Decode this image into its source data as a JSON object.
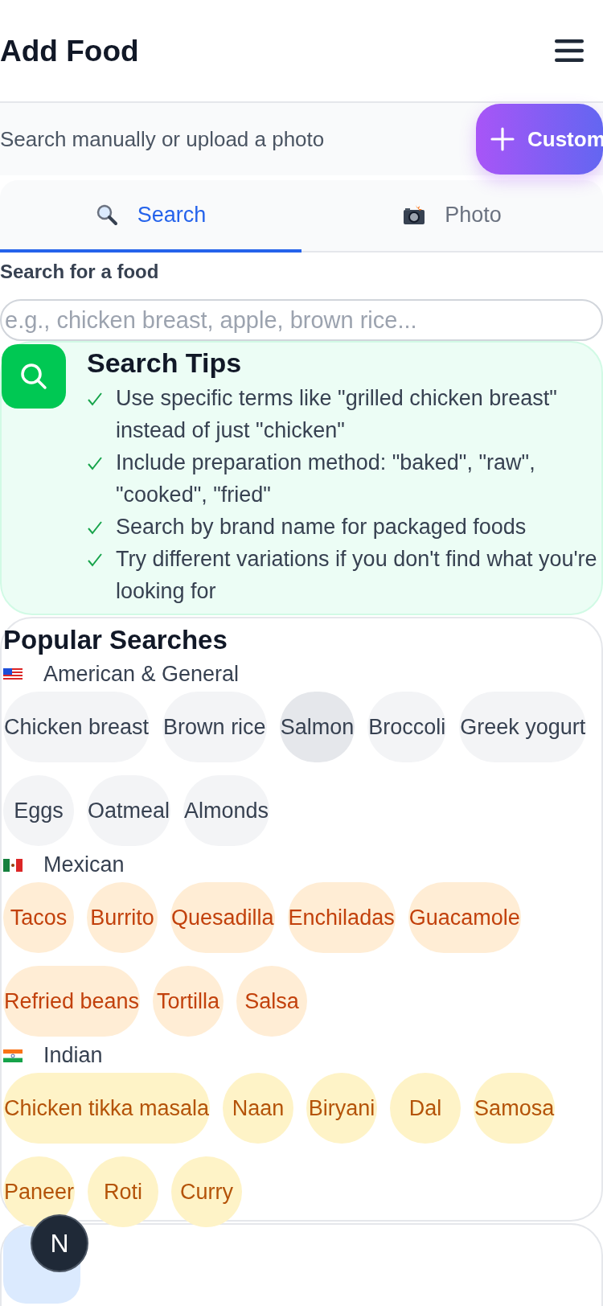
{
  "header": {
    "title": "Add Food"
  },
  "subheader": {
    "text": "Search manually or upload a photo",
    "custom_button": "Custom"
  },
  "tabs": [
    {
      "label": "Search",
      "selected": true
    },
    {
      "label": "Photo",
      "selected": false
    }
  ],
  "search": {
    "label": "Search for a food",
    "placeholder": "e.g., chicken breast, apple, brown rice..."
  },
  "tips": {
    "title": "Search Tips",
    "items": [
      "Use specific terms like \"grilled chicken breast\" instead of just \"chicken\"",
      "Include preparation method: \"baked\", \"raw\", \"cooked\", \"fried\"",
      "Search by brand name for packaged foods",
      "Try different variations if you don't find what you're looking for"
    ]
  },
  "popular": {
    "title": "Popular Searches",
    "groups": [
      {
        "label": "American & General",
        "kind": "neutral",
        "chips": [
          {
            "label": "Chicken breast",
            "highlighted": false
          },
          {
            "label": "Brown rice",
            "highlighted": false
          },
          {
            "label": "Salmon",
            "highlighted": true
          },
          {
            "label": "Broccoli",
            "highlighted": false
          },
          {
            "label": "Greek yogurt",
            "highlighted": false
          },
          {
            "label": "Eggs",
            "highlighted": false
          },
          {
            "label": "Oatmeal",
            "highlighted": false
          },
          {
            "label": "Almonds",
            "highlighted": false
          }
        ]
      },
      {
        "label": "Mexican",
        "kind": "orange",
        "chips": [
          {
            "label": "Tacos",
            "highlighted": false
          },
          {
            "label": "Burrito",
            "highlighted": false
          },
          {
            "label": "Quesadilla",
            "highlighted": false
          },
          {
            "label": "Enchiladas",
            "highlighted": false
          },
          {
            "label": "Guacamole",
            "highlighted": false
          },
          {
            "label": "Refried beans",
            "highlighted": false
          },
          {
            "label": "Tortilla",
            "highlighted": false
          },
          {
            "label": "Salsa",
            "highlighted": false
          }
        ]
      },
      {
        "label": "Indian",
        "kind": "amber",
        "chips": [
          {
            "label": "Chicken tikka masala",
            "highlighted": false
          },
          {
            "label": "Naan",
            "highlighted": false
          },
          {
            "label": "Biryani",
            "highlighted": false
          },
          {
            "label": "Dal",
            "highlighted": false
          },
          {
            "label": "Samosa",
            "highlighted": false
          },
          {
            "label": "Paneer",
            "highlighted": false
          },
          {
            "label": "Roti",
            "highlighted": false
          },
          {
            "label": "Curry",
            "highlighted": false
          }
        ]
      }
    ]
  },
  "badge": {
    "letter": "N"
  }
}
